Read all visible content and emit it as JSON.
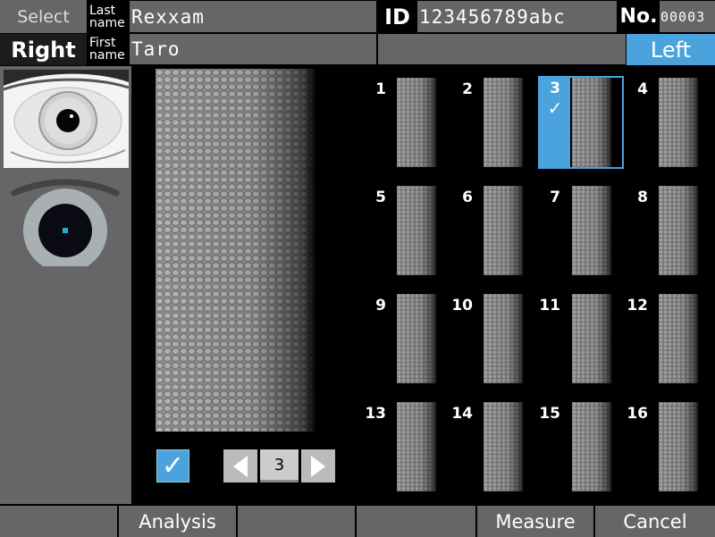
{
  "header": {
    "select_label": "Select",
    "eye_side_label": "Right",
    "last_name_label": [
      "Last",
      "name"
    ],
    "last_name_value": "Rexxam",
    "first_name_label": [
      "First",
      "name"
    ],
    "first_name_value": "Taro",
    "id_label": "ID",
    "id_value": "123456789abc",
    "no_label": "No.",
    "no_value": "00003",
    "other_eye_label": "Left"
  },
  "viewer": {
    "selected_image": "3",
    "include_checked": true,
    "check_glyph": "✓",
    "page_value": "3",
    "thumbnails": [
      "1",
      "2",
      "3",
      "4",
      "5",
      "6",
      "7",
      "8",
      "9",
      "10",
      "11",
      "12",
      "13",
      "14",
      "15",
      "16"
    ]
  },
  "bottom_bar": {
    "buttons": [
      "",
      "Analysis",
      "",
      "",
      "Measure",
      "Cancel"
    ]
  },
  "colors": {
    "accent": "#4aa3dd",
    "panel": "#666666",
    "background": "#000000"
  }
}
